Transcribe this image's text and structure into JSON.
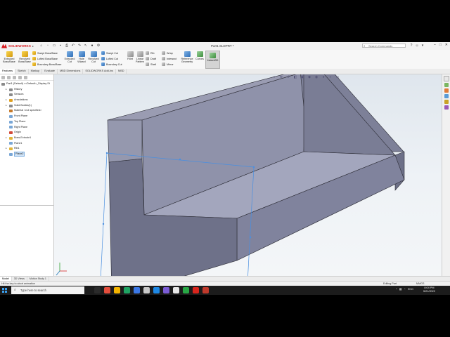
{
  "app": {
    "logo_text": "SOLIDWORKS",
    "document_title": "Part1.SLDPRT *",
    "search_placeholder": "Search Commands",
    "window_controls": [
      "–",
      "□",
      "✕"
    ]
  },
  "ribbon": {
    "extruded_boss": "Extruded Boss/Base",
    "revolved_boss": "Revolved Boss/Base",
    "swept_boss": "Swept Boss/Base",
    "lofted_boss": "Lofted Boss/Base",
    "boundary_boss": "Boundary Boss/Base",
    "extruded_cut": "Extruded Cut",
    "hole_wizard": "Hole Wizard",
    "revolved_cut": "Revolved Cut",
    "swept_cut": "Swept Cut",
    "lofted_cut": "Lofted Cut",
    "boundary_cut": "Boundary Cut",
    "fillet": "Fillet",
    "linear_pattern": "Linear Pattern",
    "rib": "Rib",
    "draft": "Draft",
    "shell": "Shell",
    "wrap": "Wrap",
    "intersect": "Intersect",
    "mirror": "Mirror",
    "reference_geometry": "Reference Geometry",
    "curves": "Curves",
    "instant3d": "Instant3D"
  },
  "command_tabs": [
    "Features",
    "Sketch",
    "Markup",
    "Evaluate",
    "MBD Dimensions",
    "SOLIDWORKS Add-Ins",
    "MBD"
  ],
  "feature_tree": {
    "root": "Part1 (Default) <<Default>_Display St",
    "items": [
      {
        "label": "History",
        "indent": 1,
        "expandable": true,
        "icon_color": "#8a8a8a"
      },
      {
        "label": "Sensors",
        "indent": 1,
        "expandable": false,
        "icon_color": "#8a8a8a"
      },
      {
        "label": "Annotations",
        "indent": 1,
        "expandable": true,
        "icon_color": "#e0a020"
      },
      {
        "label": "Solid Bodies(1)",
        "indent": 1,
        "expandable": true,
        "icon_color": "#8a8a8a"
      },
      {
        "label": "Material <not specified>",
        "indent": 1,
        "expandable": false,
        "icon_color": "#c67a2a"
      },
      {
        "label": "Front Plane",
        "indent": 1,
        "expandable": false,
        "icon_color": "#7aa7d6"
      },
      {
        "label": "Top Plane",
        "indent": 1,
        "expandable": false,
        "icon_color": "#7aa7d6"
      },
      {
        "label": "Right Plane",
        "indent": 1,
        "expandable": false,
        "icon_color": "#7aa7d6"
      },
      {
        "label": "Origin",
        "indent": 1,
        "expandable": false,
        "icon_color": "#d24a3a"
      },
      {
        "label": "Boss-Extrude1",
        "indent": 1,
        "expandable": true,
        "icon_color": "#e2b53a"
      },
      {
        "label": "Plane1",
        "indent": 1,
        "expandable": false,
        "icon_color": "#7aa7d6"
      },
      {
        "label": "Rib1",
        "indent": 1,
        "expandable": true,
        "icon_color": "#e2b53a"
      },
      {
        "label": "Plane2",
        "indent": 1,
        "expandable": false,
        "icon_color": "#7aa7d6",
        "selected": true
      }
    ]
  },
  "bottom_tabs": [
    "Model",
    "3D Views",
    "Motion Study 1"
  ],
  "status": {
    "hint": "Hit the key to abort animation",
    "mode": "Editing Part",
    "units": "MMGS"
  },
  "taskbar": {
    "search_placeholder": "Type here to search",
    "language": "ENG",
    "time": "8:04 PM",
    "date": "5/21/2022",
    "app_colors": [
      "#2b2b2b",
      "#e34d3c",
      "#f4b400",
      "#1fa463",
      "#3b78e7",
      "#c9c9c9",
      "#1e88e5",
      "#7b5cd6",
      "#e8e8e8",
      "#28a745",
      "#d9251d",
      "#c0392b"
    ]
  }
}
